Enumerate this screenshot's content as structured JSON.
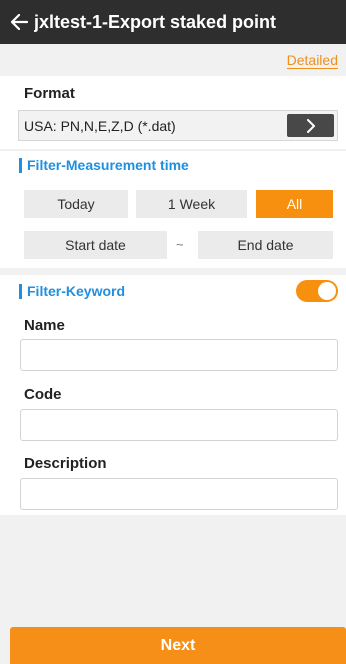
{
  "header": {
    "back_icon": "arrow-left-icon",
    "title": "jxltest-1-Export staked point"
  },
  "detailed_link": "Detailed",
  "format": {
    "label": "Format",
    "value": "USA: PN,N,E,Z,D (*.dat)",
    "button_icon": "chevron-right-icon"
  },
  "filter_time": {
    "title": "Filter-Measurement time",
    "options": [
      "Today",
      "1 Week",
      "All"
    ],
    "selected": "All",
    "start_date_placeholder": "Start date",
    "separator": "~",
    "end_date_placeholder": "End date"
  },
  "filter_keyword": {
    "title": "Filter-Keyword",
    "toggle_on": true,
    "fields": [
      {
        "label": "Name",
        "value": ""
      },
      {
        "label": "Code",
        "value": ""
      },
      {
        "label": "Description",
        "value": ""
      }
    ]
  },
  "next_button": "Next",
  "colors": {
    "accent": "#f7900f",
    "section_title": "#1f8fe0",
    "header_bg": "#2e2e2e"
  }
}
